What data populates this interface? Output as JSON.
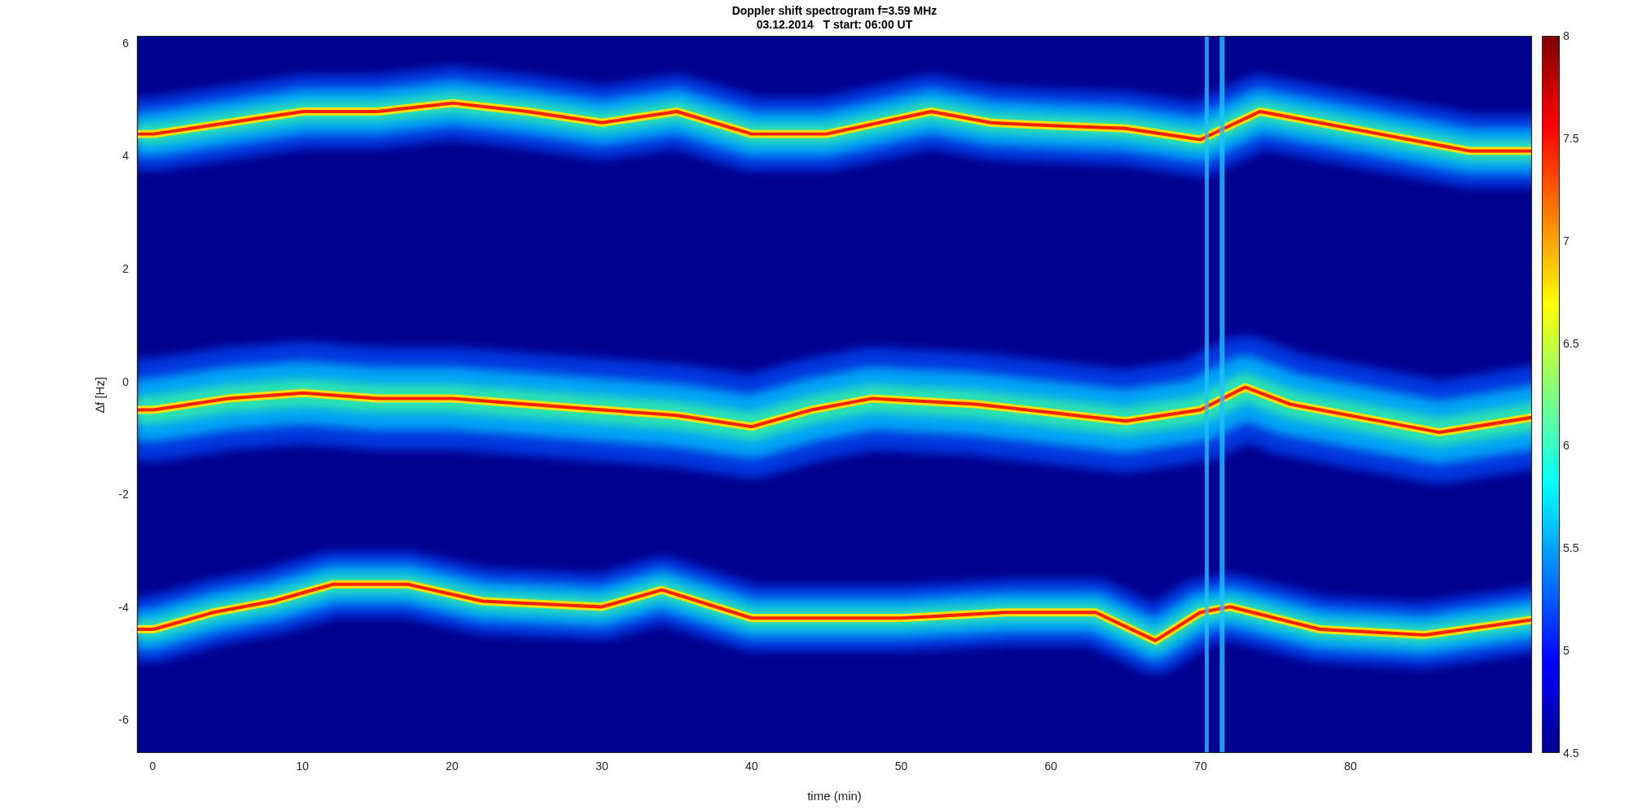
{
  "figure": {
    "title": "Doppler shift spectrogram f=3.59 MHz",
    "subtitle": "03.12.2014   T start: 06:00 UT",
    "xlabel": "time (min)",
    "ylabel": "∆f [Hz]",
    "xticks": [
      "0",
      "10",
      "20",
      "30",
      "40",
      "50",
      "60",
      "70",
      "80"
    ],
    "yticks": [
      "6",
      "4",
      "2",
      "0",
      "-2",
      "-4",
      "-6"
    ],
    "colorbar_ticks": [
      "8",
      "7.5",
      "7",
      "6.5",
      "6",
      "5.5",
      "5",
      "4.5"
    ]
  }
}
